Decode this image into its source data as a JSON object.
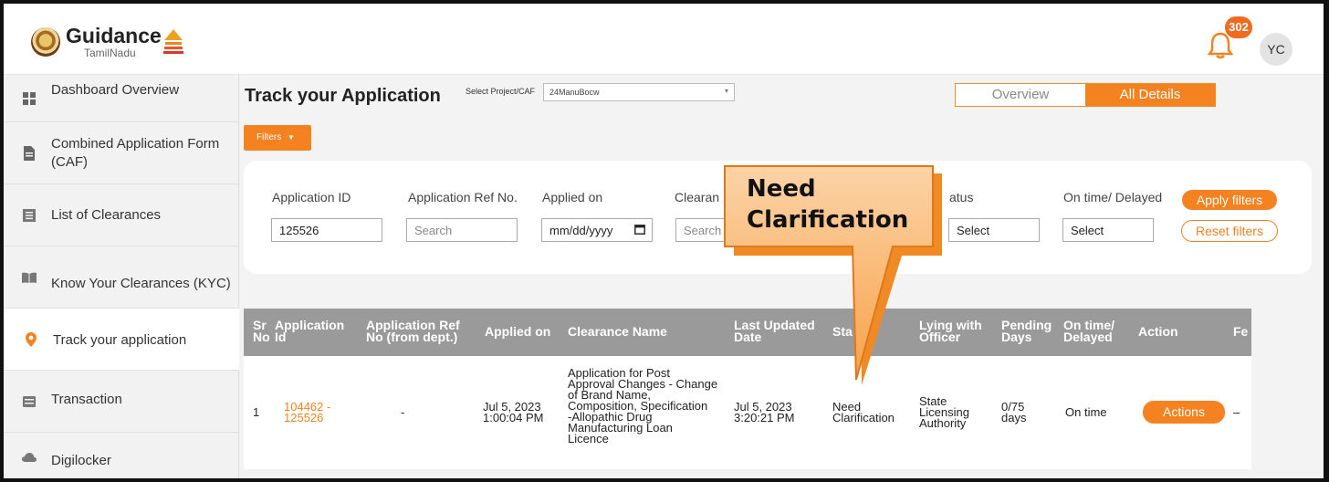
{
  "header": {
    "logo_title": "Guidance",
    "logo_subtitle": "TamilNadu",
    "notification_count": "302",
    "user_initials": "YC"
  },
  "sidebar": {
    "items": [
      {
        "label": "Dashboard Overview",
        "icon": "grid-icon"
      },
      {
        "label": "Combined Application Form (CAF)",
        "icon": "document-icon"
      },
      {
        "label": "List of Clearances",
        "icon": "list-icon"
      },
      {
        "label": "Know Your Clearances (KYC)",
        "icon": "book-icon"
      },
      {
        "label": "Track your application",
        "icon": "location-pin-icon",
        "active": true
      },
      {
        "label": "Transaction",
        "icon": "card-icon"
      },
      {
        "label": "Digilocker",
        "icon": "cloud-icon"
      }
    ]
  },
  "main": {
    "title": "Track your Application",
    "select_label": "Select Project/CAF",
    "select_value": "24ManuBocw",
    "view_tabs": [
      "Overview",
      "All Details"
    ],
    "active_tab": "All Details",
    "filters_button": "Filters"
  },
  "filters": {
    "labels": {
      "application_id": "Application ID",
      "application_ref": "Application Ref No.",
      "applied_on": "Applied on",
      "clearance": "Clearan",
      "status": "atus",
      "ontime": "On time/ Delayed"
    },
    "application_id_value": "125526",
    "application_ref_placeholder": "Search",
    "applied_on_placeholder": "mm/dd/yyyy",
    "clearance_placeholder": "Search",
    "status_select": "Select",
    "ontime_select": "Select",
    "apply_label": "Apply filters",
    "reset_label": "Reset filters"
  },
  "table": {
    "headers": {
      "sr": "Sr\nNo",
      "app_id": "Application\nId",
      "app_ref": "Application Ref\nNo (from dept.)",
      "applied_on": "Applied on",
      "clearance": "Clearance Name",
      "last_updated": "Last Updated\nDate",
      "status": "Sta",
      "lying_with": "Lying with\nOfficer",
      "pending": "Pending\nDays",
      "ontime": "On time/\nDelayed",
      "action": "Action",
      "fee": "Fe"
    },
    "rows": [
      {
        "sr": "1",
        "app_id": "104462 -\n125526",
        "app_ref": "-",
        "applied_on": "Jul 5, 2023\n1:00:04 PM",
        "clearance": "Application for Post\nApproval Changes - Change\nof Brand Name,\nComposition, Specification\n-Allopathic Drug\nManufacturing Loan\nLicence",
        "last_updated": "Jul 5, 2023\n3:20:21 PM",
        "status": "Need\nClarification",
        "lying_with": "State\nLicensing\nAuthority",
        "pending": "0/75\ndays",
        "ontime": "On time",
        "action": "Actions",
        "fee": "–"
      }
    ]
  },
  "callout": {
    "text": "Need\nClarification",
    "color": "#f7a24a"
  },
  "colors": {
    "accent": "#f58220",
    "table_header": "#9a9a9a",
    "sidebar_bg": "#f2f2f2"
  }
}
